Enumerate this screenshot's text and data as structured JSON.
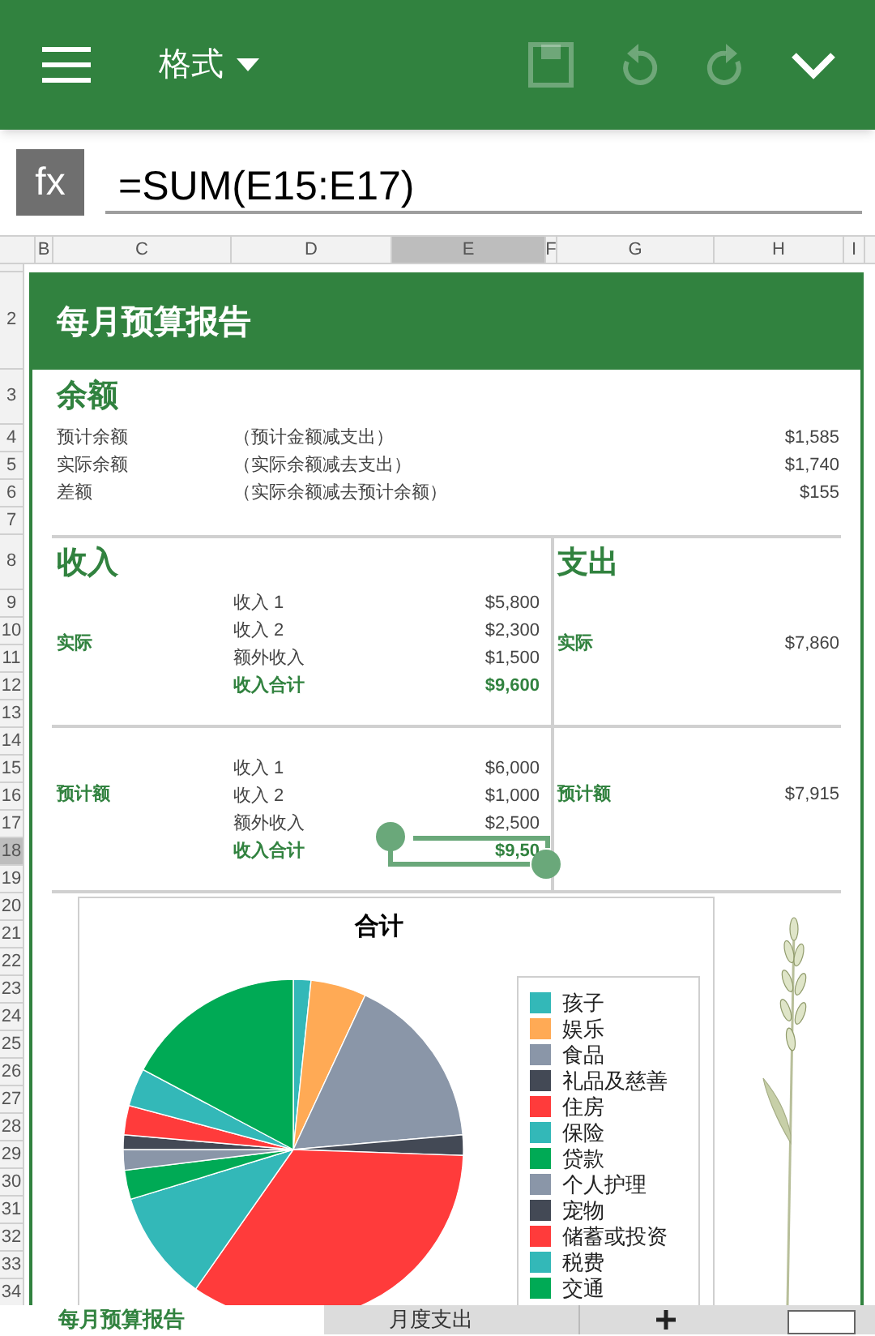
{
  "toolbar": {
    "format_menu": "格式",
    "buttons": [
      {
        "kind": "menu",
        "disabled": false
      },
      {
        "kind": "save",
        "disabled": true
      },
      {
        "kind": "undo",
        "disabled": true
      },
      {
        "kind": "redo",
        "disabled": true
      },
      {
        "kind": "collapse",
        "disabled": false
      }
    ]
  },
  "formula_bar": {
    "label": "fx",
    "formula": "=SUM(E15:E17)"
  },
  "column_headers": [
    {
      "label": "B",
      "selected": false
    },
    {
      "label": "C",
      "selected": false
    },
    {
      "label": "D",
      "selected": false
    },
    {
      "label": "E",
      "selected": true
    },
    {
      "label": "F",
      "selected": false
    },
    {
      "label": "G",
      "selected": false
    },
    {
      "label": "H",
      "selected": false
    },
    {
      "label": "I",
      "selected": false
    }
  ],
  "row_headers": [
    {
      "label": "2",
      "selected": false
    },
    {
      "label": "3",
      "selected": false
    },
    {
      "label": "4",
      "selected": false
    },
    {
      "label": "5",
      "selected": false
    },
    {
      "label": "6",
      "selected": false
    },
    {
      "label": "7",
      "selected": false
    },
    {
      "label": "8",
      "selected": false
    },
    {
      "label": "9",
      "selected": false
    },
    {
      "label": "10",
      "selected": false
    },
    {
      "label": "11",
      "selected": false
    },
    {
      "label": "12",
      "selected": false
    },
    {
      "label": "13",
      "selected": false
    },
    {
      "label": "14",
      "selected": false
    },
    {
      "label": "15",
      "selected": false
    },
    {
      "label": "16",
      "selected": false
    },
    {
      "label": "17",
      "selected": false
    },
    {
      "label": "18",
      "selected": true
    },
    {
      "label": "19",
      "selected": false
    },
    {
      "label": "20",
      "selected": false
    },
    {
      "label": "21",
      "selected": false
    },
    {
      "label": "22",
      "selected": false
    },
    {
      "label": "23",
      "selected": false
    },
    {
      "label": "24",
      "selected": false
    },
    {
      "label": "25",
      "selected": false
    },
    {
      "label": "26",
      "selected": false
    },
    {
      "label": "27",
      "selected": false
    },
    {
      "label": "28",
      "selected": false
    },
    {
      "label": "29",
      "selected": false
    },
    {
      "label": "30",
      "selected": false
    },
    {
      "label": "31",
      "selected": false
    },
    {
      "label": "32",
      "selected": false
    },
    {
      "label": "33",
      "selected": false
    },
    {
      "label": "34",
      "selected": false
    }
  ],
  "report": {
    "title": "每月预算报告",
    "balance": {
      "heading": "余额",
      "rows": [
        {
          "label": "预计余额",
          "note": "（预计金额减支出）",
          "amount": "$1,585"
        },
        {
          "label": "实际余额",
          "note": "（实际余额减去支出）",
          "amount": "$1,740"
        },
        {
          "label": "差额",
          "note": "（实际余额减去预计余额）",
          "amount": "$155"
        }
      ]
    },
    "income": {
      "heading": "收入",
      "blocks": [
        {
          "label": "实际",
          "items": [
            {
              "name": "收入 1",
              "amount": "$5,800",
              "kind": "item"
            },
            {
              "name": "收入 2",
              "amount": "$2,300",
              "kind": "item"
            },
            {
              "name": "额外收入",
              "amount": "$1,500",
              "kind": "item"
            },
            {
              "name": "收入合计",
              "amount": "$9,600",
              "kind": "total"
            }
          ]
        },
        {
          "label": "预计额",
          "items": [
            {
              "name": "收入 1",
              "amount": "$6,000",
              "kind": "item"
            },
            {
              "name": "收入 2",
              "amount": "$1,000",
              "kind": "item"
            },
            {
              "name": "额外收入",
              "amount": "$2,500",
              "kind": "item"
            },
            {
              "name": "收入合计",
              "amount": "$9,50",
              "kind": "total"
            }
          ]
        }
      ]
    },
    "expenses": {
      "heading": "支出",
      "blocks": [
        {
          "label": "实际",
          "amount": "$7,860"
        },
        {
          "label": "预计额",
          "amount": "$7,915"
        }
      ]
    },
    "chart": {
      "title": "合计",
      "legend": [
        {
          "label": "孩子",
          "color": "#33b8b8"
        },
        {
          "label": "娱乐",
          "color": "#ffaa55"
        },
        {
          "label": "食品",
          "color": "#8a96a8"
        },
        {
          "label": "礼品及慈善",
          "color": "#434955"
        },
        {
          "label": "住房",
          "color": "#ff3b3b"
        },
        {
          "label": "保险",
          "color": "#33b8b8"
        },
        {
          "label": "贷款",
          "color": "#00aa55"
        },
        {
          "label": "个人护理",
          "color": "#8a96a8"
        },
        {
          "label": "宠物",
          "color": "#434955"
        },
        {
          "label": "储蓄或投资",
          "color": "#ff3b3b"
        },
        {
          "label": "税费",
          "color": "#33b8b8"
        },
        {
          "label": "交通",
          "color": "#00aa55"
        }
      ]
    }
  },
  "sheet_tabs": [
    {
      "label": "每月预算报告",
      "selected": true
    },
    {
      "label": "月度支出",
      "selected": false
    }
  ]
}
